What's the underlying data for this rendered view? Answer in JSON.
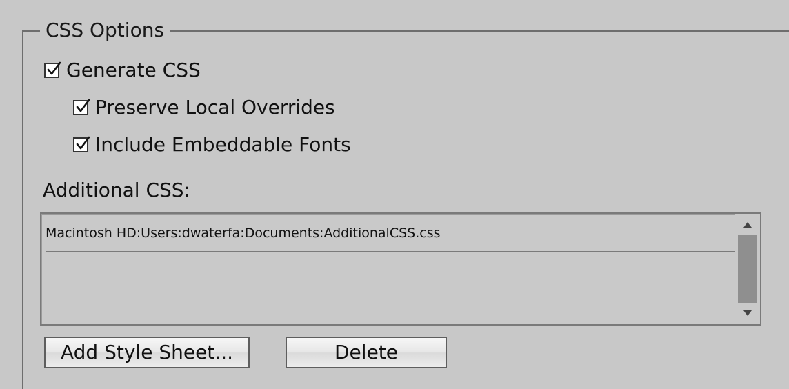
{
  "group": {
    "legend": "CSS Options"
  },
  "options": {
    "generate_css": {
      "label": "Generate CSS",
      "checked": true
    },
    "preserve_overrides": {
      "label": "Preserve Local Overrides",
      "checked": true
    },
    "include_fonts": {
      "label": "Include Embeddable Fonts",
      "checked": true
    }
  },
  "additional_css": {
    "label": "Additional CSS:",
    "items": [
      "Macintosh HD:Users:dwaterfa:Documents:AdditionalCSS.css"
    ]
  },
  "buttons": {
    "add_label": "Add Style Sheet...",
    "delete_label": "Delete"
  },
  "icons": {
    "checkbox_check": "checkmark-icon",
    "scroll_up": "triangle-up-icon",
    "scroll_down": "triangle-down-icon"
  }
}
